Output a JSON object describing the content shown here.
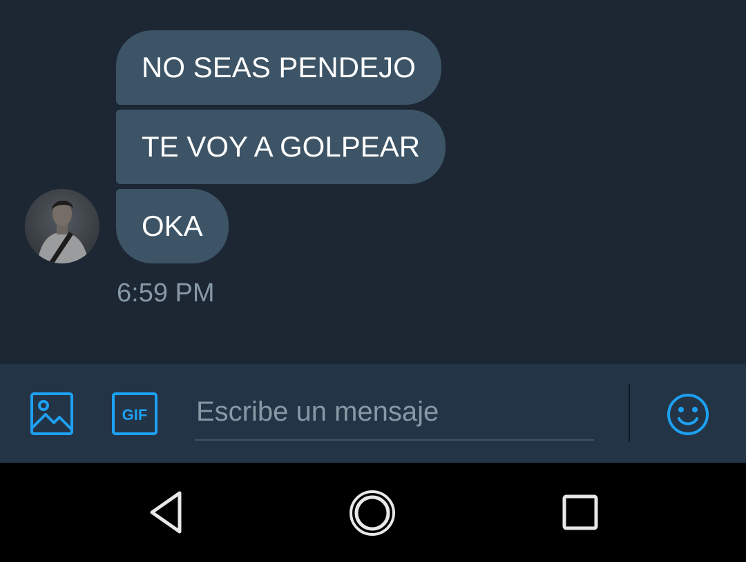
{
  "thread": {
    "messages": [
      {
        "text": "NO SEAS PENDEJO"
      },
      {
        "text": "TE VOY A GOLPEAR"
      },
      {
        "text": "OKA"
      }
    ],
    "timestamp": "6:59 PM"
  },
  "composer": {
    "placeholder": "Escribe un mensaje",
    "gif_label": "GIF",
    "icons": [
      "image-icon",
      "gif-icon",
      "emoji-icon"
    ]
  },
  "navbar": {
    "icons": [
      "back-icon",
      "home-icon",
      "recents-icon"
    ]
  },
  "colors": {
    "background": "#1c2733",
    "bubble": "#3d5466",
    "composer": "#243447",
    "accent": "#1da1f2",
    "muted_text": "#8899a6"
  }
}
